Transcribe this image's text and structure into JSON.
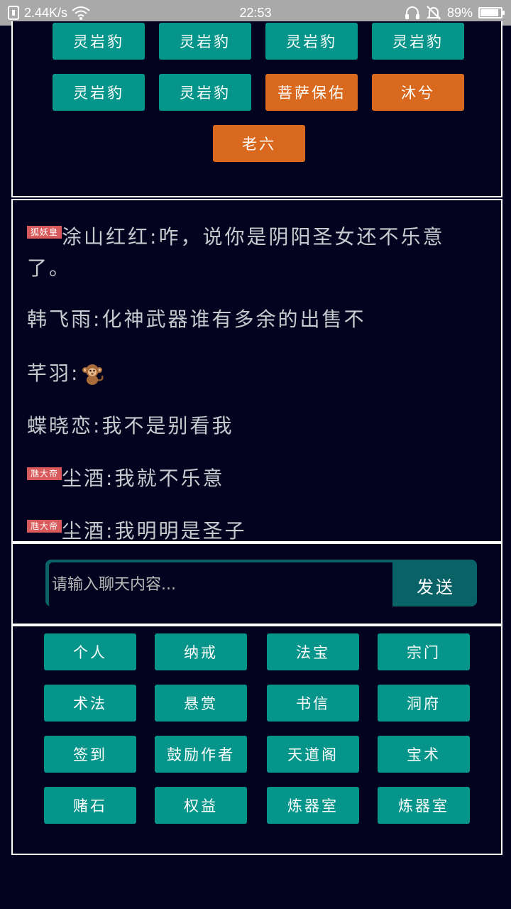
{
  "status_bar": {
    "net_speed": "2.44K/s",
    "time": "22:53",
    "battery_percent": "89%",
    "battery_level": 0.89,
    "icons": [
      "sim-icon",
      "wifi-icon",
      "headphones-icon",
      "mute-icon",
      "battery-icon"
    ]
  },
  "top_buttons": [
    {
      "label": "灵岩豹",
      "color": "#06958a"
    },
    {
      "label": "灵岩豹",
      "color": "#06958a"
    },
    {
      "label": "灵岩豹",
      "color": "#06958a"
    },
    {
      "label": "灵岩豹",
      "color": "#06958a"
    },
    {
      "label": "灵岩豹",
      "color": "#06958a"
    },
    {
      "label": "灵岩豹",
      "color": "#06958a"
    },
    {
      "label": "菩萨保佑",
      "color": "#d9691f"
    },
    {
      "label": "沐兮",
      "color": "#d9691f"
    },
    {
      "label": "老六",
      "color": "#d9691f"
    }
  ],
  "chat": {
    "messages": [
      {
        "badge": "狐妖皇",
        "sender": "涂山红红",
        "separator": ":",
        "text": "咋，说你是阴阳圣女还不乐意了。"
      },
      {
        "badge": "",
        "sender": "韩飞雨",
        "separator": ":",
        "text": "化神武器谁有多余的出售不"
      },
      {
        "badge": "",
        "sender": "芊羽",
        "separator": ":",
        "text": "",
        "emoji": "monkey-icon"
      },
      {
        "badge": "",
        "sender": "蝶晓恋",
        "separator": ":",
        "text": "我不是别看我"
      },
      {
        "badge": "虺大帝",
        "sender": "尘酒",
        "separator": ":",
        "text": "我就不乐意"
      },
      {
        "badge": "虺大帝",
        "sender": "尘酒",
        "separator": ":",
        "text": "我明明是圣子"
      }
    ]
  },
  "input": {
    "placeholder": "请输入聊天内容...",
    "value": "",
    "send_label": "发送"
  },
  "menu": [
    "个人",
    "纳戒",
    "法宝",
    "宗门",
    "术法",
    "悬赏",
    "书信",
    "洞府",
    "签到",
    "鼓励作者",
    "天道阁",
    "宝术",
    "赌石",
    "权益",
    "炼器室",
    "炼器室"
  ],
  "colors": {
    "background": "#03031f",
    "teal": "#06958a",
    "orange": "#d9691f",
    "badge": "#d95a5a",
    "chat_text": "#c4cccf",
    "input_frame": "#086266"
  }
}
